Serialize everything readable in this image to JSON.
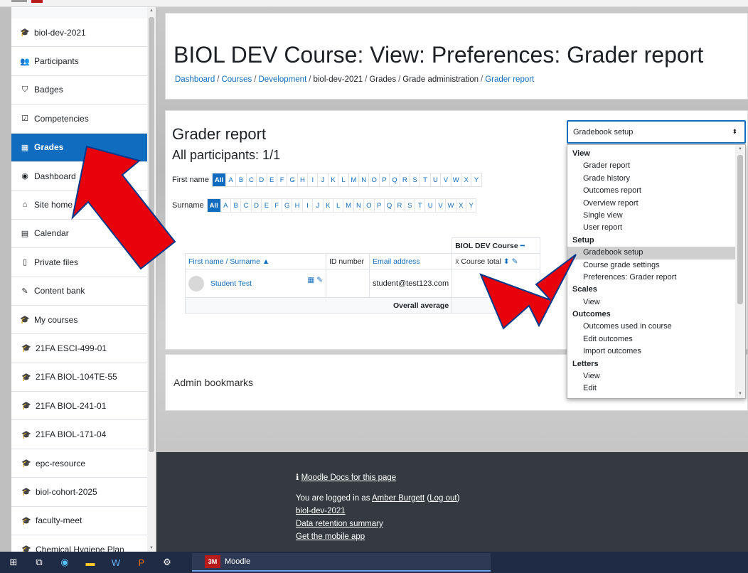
{
  "sidebar": {
    "items": [
      {
        "icon": "graduation-cap-icon",
        "glyph": "🎓",
        "label": "biol-dev-2021"
      },
      {
        "icon": "users-icon",
        "glyph": "👥",
        "label": "Participants"
      },
      {
        "icon": "shield-icon",
        "glyph": "⛉",
        "label": "Badges"
      },
      {
        "icon": "check-square-icon",
        "glyph": "☑",
        "label": "Competencies"
      },
      {
        "icon": "table-icon",
        "glyph": "▦",
        "label": "Grades",
        "active": true
      },
      {
        "icon": "dashboard-icon",
        "glyph": "◉",
        "label": "Dashboard"
      },
      {
        "icon": "home-icon",
        "glyph": "⌂",
        "label": "Site home"
      },
      {
        "icon": "calendar-icon",
        "glyph": "▤",
        "label": "Calendar"
      },
      {
        "icon": "file-icon",
        "glyph": "▯",
        "label": "Private files"
      },
      {
        "icon": "pen-icon",
        "glyph": "✎",
        "label": "Content bank"
      },
      {
        "icon": "graduation-cap-icon",
        "glyph": "🎓",
        "label": "My courses"
      },
      {
        "icon": "graduation-cap-icon",
        "glyph": "🎓",
        "label": "21FA ESCI-499-01"
      },
      {
        "icon": "graduation-cap-icon",
        "glyph": "🎓",
        "label": "21FA BIOL-104TE-55"
      },
      {
        "icon": "graduation-cap-icon",
        "glyph": "🎓",
        "label": "21FA BIOL-241-01"
      },
      {
        "icon": "graduation-cap-icon",
        "glyph": "🎓",
        "label": "21FA BIOL-171-04"
      },
      {
        "icon": "graduation-cap-icon",
        "glyph": "🎓",
        "label": "epc-resource"
      },
      {
        "icon": "graduation-cap-icon",
        "glyph": "🎓",
        "label": "biol-cohort-2025"
      },
      {
        "icon": "graduation-cap-icon",
        "glyph": "🎓",
        "label": "faculty-meet"
      },
      {
        "icon": "graduation-cap-icon",
        "glyph": "🎓",
        "label": "Chemical Hygiene Plan"
      }
    ]
  },
  "header": {
    "title": "BIOL DEV Course: View: Preferences: Grader report",
    "breadcrumbs": [
      {
        "label": "Dashboard",
        "link": true
      },
      {
        "label": "Courses",
        "link": true
      },
      {
        "label": "Development",
        "link": true
      },
      {
        "label": "biol-dev-2021",
        "link": false
      },
      {
        "label": "Grades",
        "link": false
      },
      {
        "label": "Grade administration",
        "link": false
      },
      {
        "label": "Grader report",
        "link": true
      }
    ]
  },
  "report": {
    "title": "Grader report",
    "participants": "All participants: 1/1",
    "firstname_label": "First name",
    "surname_label": "Surname",
    "all_label": "All",
    "letters": [
      "A",
      "B",
      "C",
      "D",
      "E",
      "F",
      "G",
      "H",
      "I",
      "J",
      "K",
      "L",
      "M",
      "N",
      "O",
      "P",
      "Q",
      "R",
      "S",
      "T",
      "U",
      "V",
      "W",
      "X",
      "Y"
    ],
    "table": {
      "course_header": "BIOL DEV Course",
      "col_name": "First name / Surname",
      "col_id": "ID number",
      "col_email": "Email address",
      "col_total": "Course total",
      "student_name": "Student Test",
      "student_email": "student@test123.com",
      "overall_label": "Overall average",
      "overall_value": "-"
    }
  },
  "bookmarks": {
    "title": "Admin bookmarks"
  },
  "select": {
    "value": "Gradebook setup",
    "groups": [
      {
        "label": "View",
        "options": [
          "Grader report",
          "Grade history",
          "Outcomes report",
          "Overview report",
          "Single view",
          "User report"
        ]
      },
      {
        "label": "Setup",
        "options": [
          "Gradebook setup",
          "Course grade settings",
          "Preferences: Grader report"
        ]
      },
      {
        "label": "Scales",
        "options": [
          "View"
        ]
      },
      {
        "label": "Outcomes",
        "options": [
          "Outcomes used in course",
          "Edit outcomes",
          "Import outcomes"
        ]
      },
      {
        "label": "Letters",
        "options": [
          "View",
          "Edit"
        ]
      }
    ],
    "highlighted": "Gradebook setup"
  },
  "footer": {
    "docs_link": "Moodle Docs for this page",
    "logged_in_prefix": "You are logged in as",
    "user": "Amber Burgett",
    "logout": "Log out",
    "course_link": "biol-dev-2021",
    "retention_link": "Data retention summary",
    "mobile_link": "Get the mobile app"
  },
  "taskbar": {
    "app_logo": "3M",
    "app_title": "Moodle"
  },
  "colors": {
    "brand": "#0f6cbf",
    "arrow": "#e8000b",
    "footer": "#343a40"
  }
}
